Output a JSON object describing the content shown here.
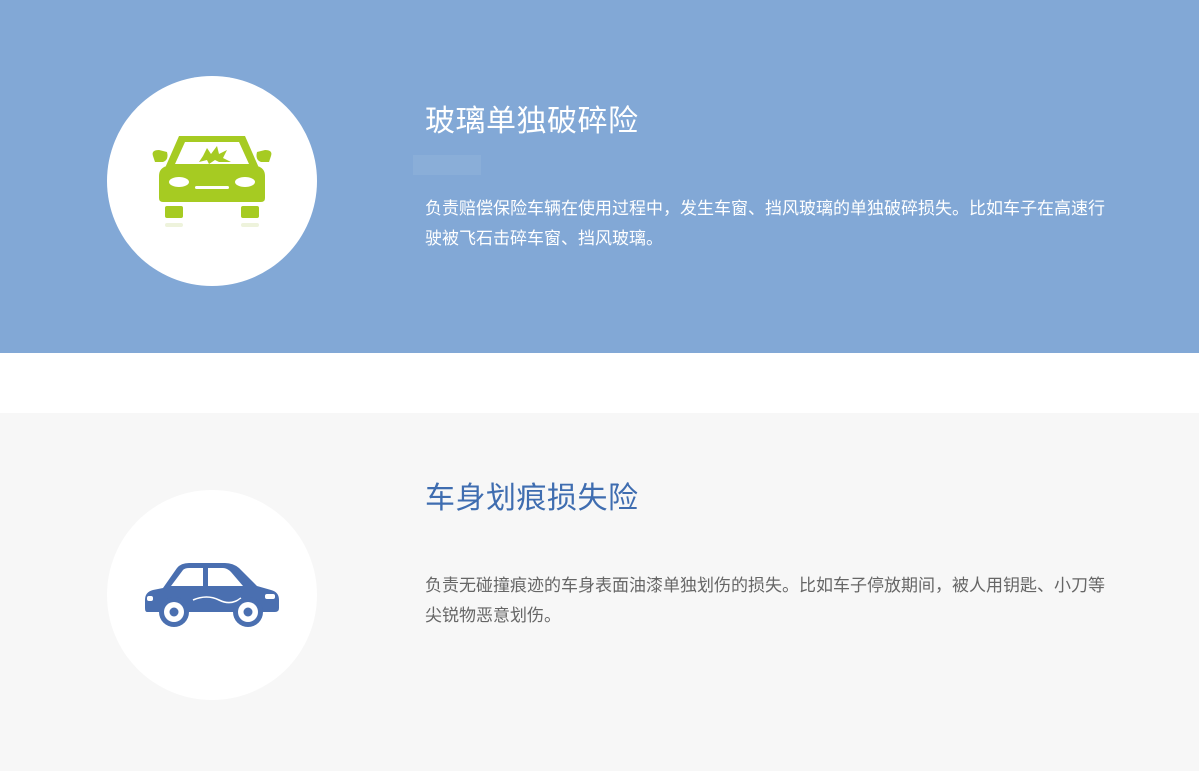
{
  "sections": [
    {
      "icon": "car-broken-glass-icon",
      "title": "玻璃单独破碎险",
      "description": "负责赔偿保险车辆在使用过程中，发生车窗、挡风玻璃的单独破碎损失。比如车子在高速行驶被飞石击碎车窗、挡风玻璃。",
      "background": "#82a8d6",
      "icon_color": "#a6cb22"
    },
    {
      "icon": "car-side-scratch-icon",
      "title": "车身划痕损失险",
      "description": "负责无碰撞痕迹的车身表面油漆单独划伤的损失。比如车子停放期间，被人用钥匙、小刀等尖锐物恶意划伤。",
      "background": "#f7f7f7",
      "icon_color": "#4a6fb0"
    }
  ]
}
